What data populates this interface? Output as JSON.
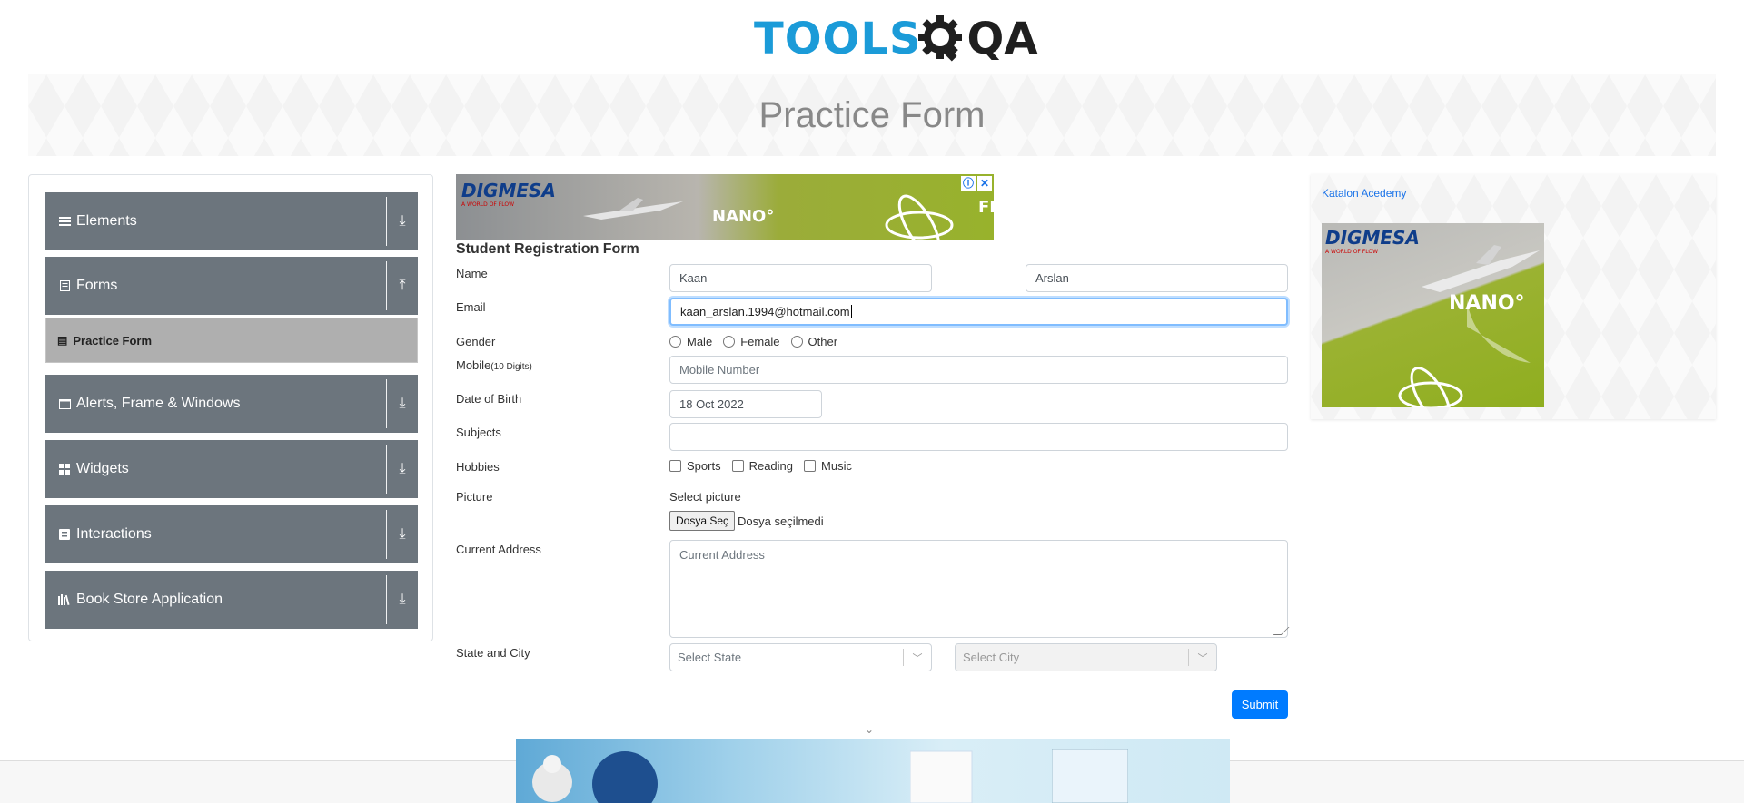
{
  "header": {
    "logo_tools": "TOOLS",
    "logo_qa": "QA"
  },
  "banner": {
    "title": "Practice Form"
  },
  "sidebar": {
    "groups": [
      {
        "label": "Elements",
        "icon": "hamburger-icon"
      },
      {
        "label": "Forms",
        "icon": "form-icon",
        "active_item": "Practice Form"
      },
      {
        "label": "Alerts, Frame & Windows",
        "icon": "window-icon"
      },
      {
        "label": "Widgets",
        "icon": "widgets-icon"
      },
      {
        "label": "Interactions",
        "icon": "interactions-icon"
      },
      {
        "label": "Book Store Application",
        "icon": "books-icon"
      }
    ]
  },
  "ads": {
    "brand": "DIGMESA",
    "tagline": "A WORLD OF FLOW",
    "nano": "NANO°",
    "fl": "FL",
    "katalon_alt": "Katalon Acedemy"
  },
  "form": {
    "title": "Student Registration Form",
    "name_label": "Name",
    "first_name": "Kaan",
    "last_name": "Arslan",
    "email_label": "Email",
    "email": "kaan_arslan.1994@hotmail.com",
    "gender_label": "Gender",
    "genders": [
      "Male",
      "Female",
      "Other"
    ],
    "mobile_label": "Mobile",
    "mobile_hint": "(10 Digits)",
    "mobile_placeholder": "Mobile Number",
    "dob_label": "Date of Birth",
    "dob": "18 Oct 2022",
    "subjects_label": "Subjects",
    "hobbies_label": "Hobbies",
    "hobbies": [
      "Sports",
      "Reading",
      "Music"
    ],
    "picture_label": "Picture",
    "picture_select": "Select picture",
    "file_button": "Dosya Seç",
    "file_none": "Dosya seçilmedi",
    "address_label": "Current Address",
    "address_placeholder": "Current Address",
    "state_city_label": "State and City",
    "state_placeholder": "Select State",
    "city_placeholder": "Select City",
    "submit": "Submit"
  },
  "colors": {
    "accent": "#007bff",
    "sidebar": "#6c757d",
    "logo_blue": "#1b9bd8"
  }
}
